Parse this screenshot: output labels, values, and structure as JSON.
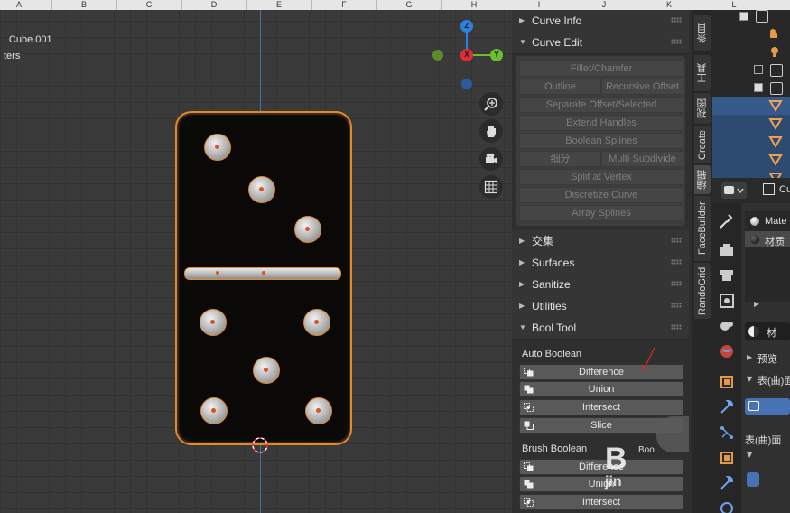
{
  "columns": [
    "A",
    "B",
    "C",
    "D",
    "E",
    "F",
    "G",
    "H",
    "I",
    "J",
    "K",
    "L"
  ],
  "viewport": {
    "object_line": "| Cube.001",
    "sub_line": "ters",
    "gizmo": {
      "z": "Z",
      "x": "X",
      "y": "Y"
    },
    "nav_icons": [
      "zoom-icon",
      "hand-pan-icon",
      "camera-icon",
      "grid-icon"
    ]
  },
  "sidebar": {
    "curve_info": "Curve Info",
    "curve_edit": "Curve Edit",
    "curve_buttons": [
      "Fillet/Chamfer",
      "Outline",
      "Recursive Offset",
      "Separate Offset/Selected",
      "Extend Handles",
      "Boolean Splines",
      "细分",
      "Multi Subdivide",
      "Split at Vertex",
      "Discretize Curve",
      "Array Splines"
    ],
    "sections": [
      "交集",
      "Surfaces",
      "Sanitize",
      "Utilities",
      "Bool Tool"
    ],
    "auto_boolean": {
      "label": "Auto Boolean",
      "buttons": [
        "Difference",
        "Union",
        "Intersect",
        "Slice"
      ]
    },
    "brush_boolean": {
      "label": "Brush Boolean",
      "buttons": [
        "Difference",
        "Union",
        "Intersect"
      ]
    },
    "watermark": {
      "big": "B",
      "small": "Boo",
      "sub": "jin"
    }
  },
  "vtabs": [
    "条目",
    "工具",
    "视图",
    "Create",
    "编辑",
    "FaceBuilder",
    "RandoGrid"
  ],
  "properties": {
    "dropdown": "Cu",
    "slots": [
      "Mate",
      "材质"
    ],
    "mat_field": "材",
    "preview": "预览",
    "surface": "表(曲)面",
    "surface_label": "表(曲)面"
  },
  "colors": {
    "accent": "#e08a2a",
    "selected": "#355a8a",
    "x_axis": "#e02c3a",
    "y_axis": "#6cbd2f",
    "z_axis": "#2d7fe0"
  }
}
